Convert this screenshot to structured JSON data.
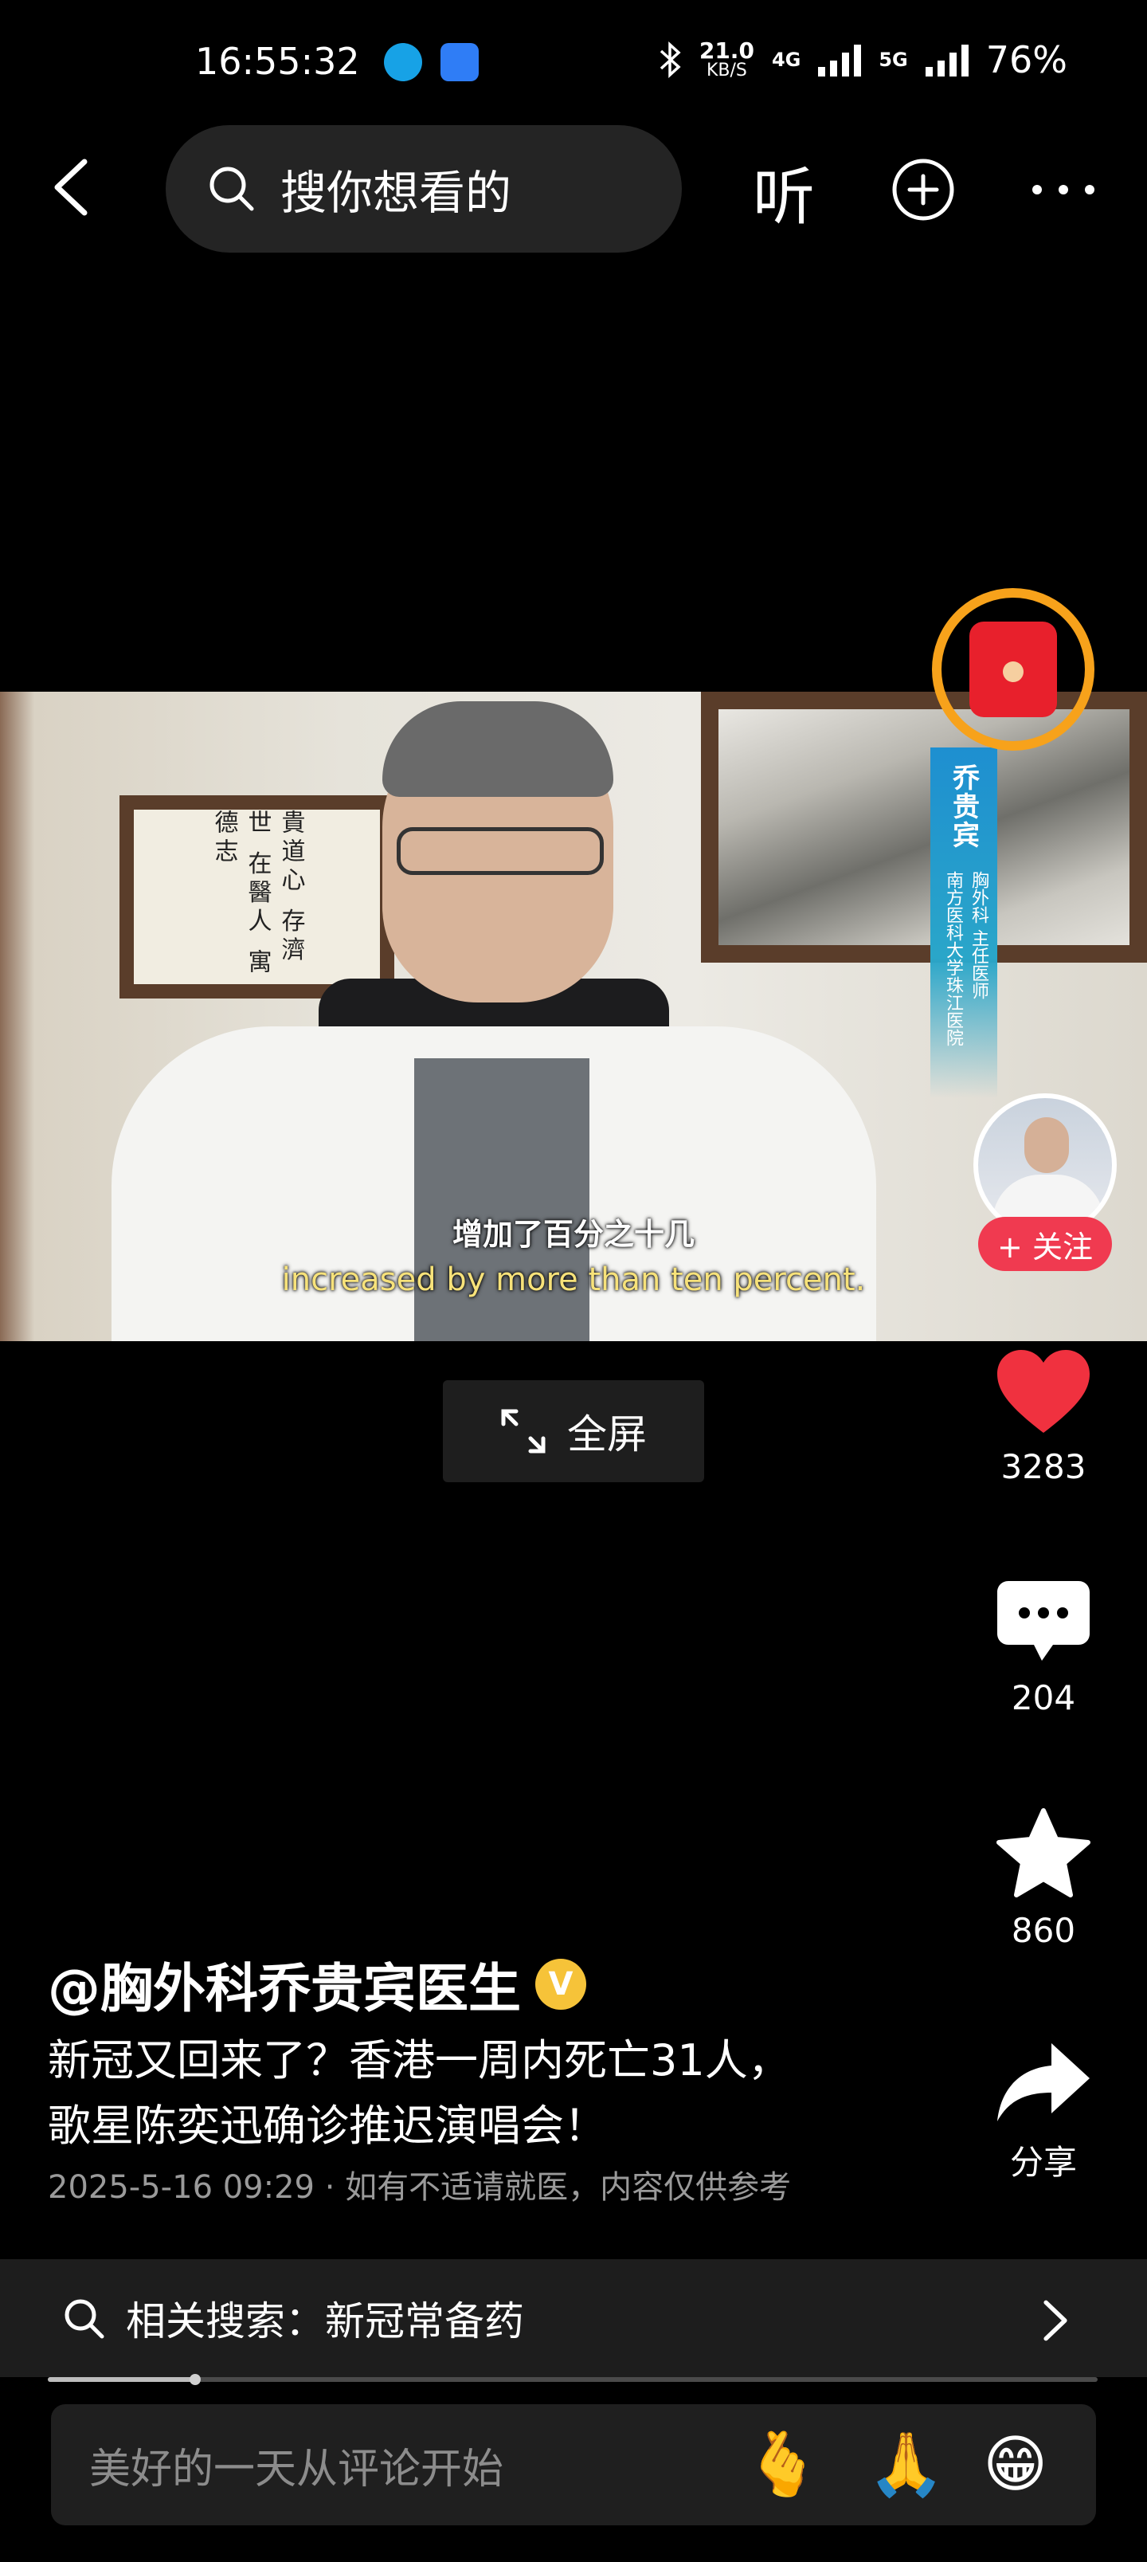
{
  "status_bar": {
    "time": "16:55:32",
    "net_speed_value": "21.0",
    "net_speed_unit": "KB/S",
    "network_4g": "4G",
    "network_5g": "5G",
    "battery": "76%"
  },
  "topbar": {
    "search_placeholder": "搜你想看的",
    "listen_label": "听"
  },
  "video": {
    "subtitle_cn": "增加了百分之十几",
    "subtitle_en": "increased by more than ten percent.",
    "banner_name": "乔贵宾",
    "banner_title": "胸外科 主任医师",
    "banner_org": "南方医科大学珠江医院",
    "calligraphy": "貴道心 存濟世 在醫人 寓德志"
  },
  "fullscreen_label": "全屏",
  "actions": {
    "follow_label": "+ 关注",
    "likes": "3283",
    "comments": "204",
    "favorites": "860",
    "share_label": "分享"
  },
  "post": {
    "author": "@胸外科乔贵宾医生",
    "verified_mark": "V",
    "description_line1": "新冠又回来了？香港一周内死亡31人，",
    "description_line2": "歌星陈奕迅确诊推迟演唱会！",
    "meta": "2025-5-16 09:29 · 如有不适请就医，内容仅供参考"
  },
  "related_search": {
    "label": "相关搜索：新冠常备药"
  },
  "progress": 0.14,
  "comment_bar": {
    "placeholder": "美好的一天从评论开始",
    "emoji1": "🫰",
    "emoji2": "🙏",
    "emoji3": "😁"
  },
  "colors": {
    "background": "#000000",
    "like_red": "#f0313f",
    "follow_red": "#f03a50",
    "red_packet_ring": "#f7a21b",
    "verified_gold": "#f6c339"
  }
}
